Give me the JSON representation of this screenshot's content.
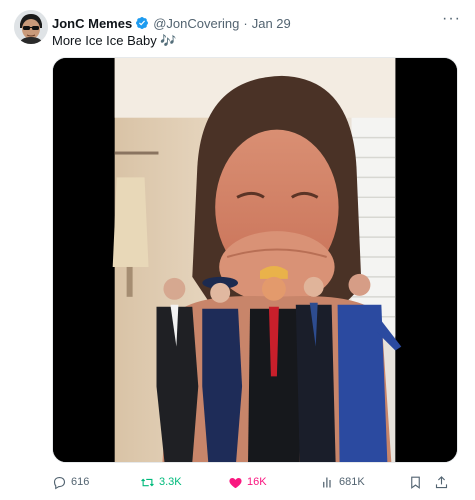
{
  "author": {
    "display_name": "JonC Memes",
    "handle": "@JonCovering",
    "separator": "·",
    "date": "Jan 29",
    "verified_icon": "verified-badge-icon",
    "avatar_icon": "avatar-sunglasses-icon"
  },
  "tweet": {
    "text": "More Ice Ice Baby",
    "emoji": "🎶",
    "more_label": "···"
  },
  "media": {
    "type": "video",
    "icon": "video-thumbnail"
  },
  "actions": {
    "replies": "616",
    "retweets": "3.3K",
    "likes": "16K",
    "views": "681K",
    "reply_icon": "reply-icon",
    "retweet_icon": "retweet-icon",
    "like_icon": "heart-icon",
    "views_icon": "views-chart-icon",
    "bookmark_icon": "bookmark-icon",
    "share_icon": "share-icon"
  },
  "colors": {
    "verified": "#1d9bf0",
    "retweet_active": "#00ba7c",
    "like_active": "#f91880",
    "secondary_text": "#536471"
  }
}
